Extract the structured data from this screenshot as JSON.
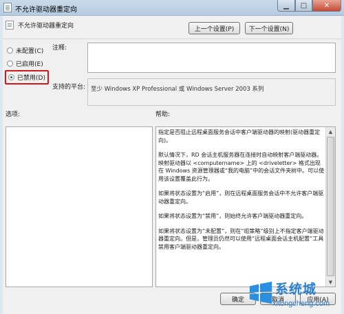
{
  "window": {
    "title": "不允许驱动器重定向"
  },
  "policy": {
    "name": "不允许驱动器重定向"
  },
  "nav": {
    "prev_label": "上一个设置(P)",
    "next_label": "下一个设置(N)"
  },
  "state_options": [
    {
      "label": "未配置(C)",
      "selected": false
    },
    {
      "label": "已启用(E)",
      "selected": false
    },
    {
      "label": "已禁用(D)",
      "selected": true
    }
  ],
  "comment": {
    "label": "注释:",
    "value": ""
  },
  "platform": {
    "label": "支持的平台:",
    "value": "至少 Windows XP Professional 或 Windows Server 2003 系列"
  },
  "options": {
    "label": "选项:"
  },
  "help": {
    "label": "帮助:",
    "paragraphs": [
      "指定是否阻止远程桌面服务会话中客户端驱动器的映射(驱动器重定向)。",
      "默认情况下，RD 会话主机服务器在连接时自动映射客户端驱动器。映射驱动器以 <computername> 上的 <driveletter> 格式出现在 Windows 资源管理器或“我的电脑”中的会话文件夹树中。可以使用该设置覆盖此行为。",
      "如果将状态设置为“启用”，则在远程桌面服务会话中不允许客户端驱动器重定向。",
      "如果将状态设置为“禁用”，则始终允许客户端驱动器重定向。",
      "如果将状态设置为“未配置”，则在“组策略”级别上不指定客户端驱动器重定向。但是，管理员仍然可以使用“远程桌面会话主机配置”工具禁用客户端驱动器重定向。"
    ]
  },
  "footer": {
    "ok_label": "确定",
    "cancel_label": "取消",
    "apply_label": "应用(A)"
  },
  "watermark": {
    "text": "系统城",
    "url": "xitongcheng.com"
  }
}
